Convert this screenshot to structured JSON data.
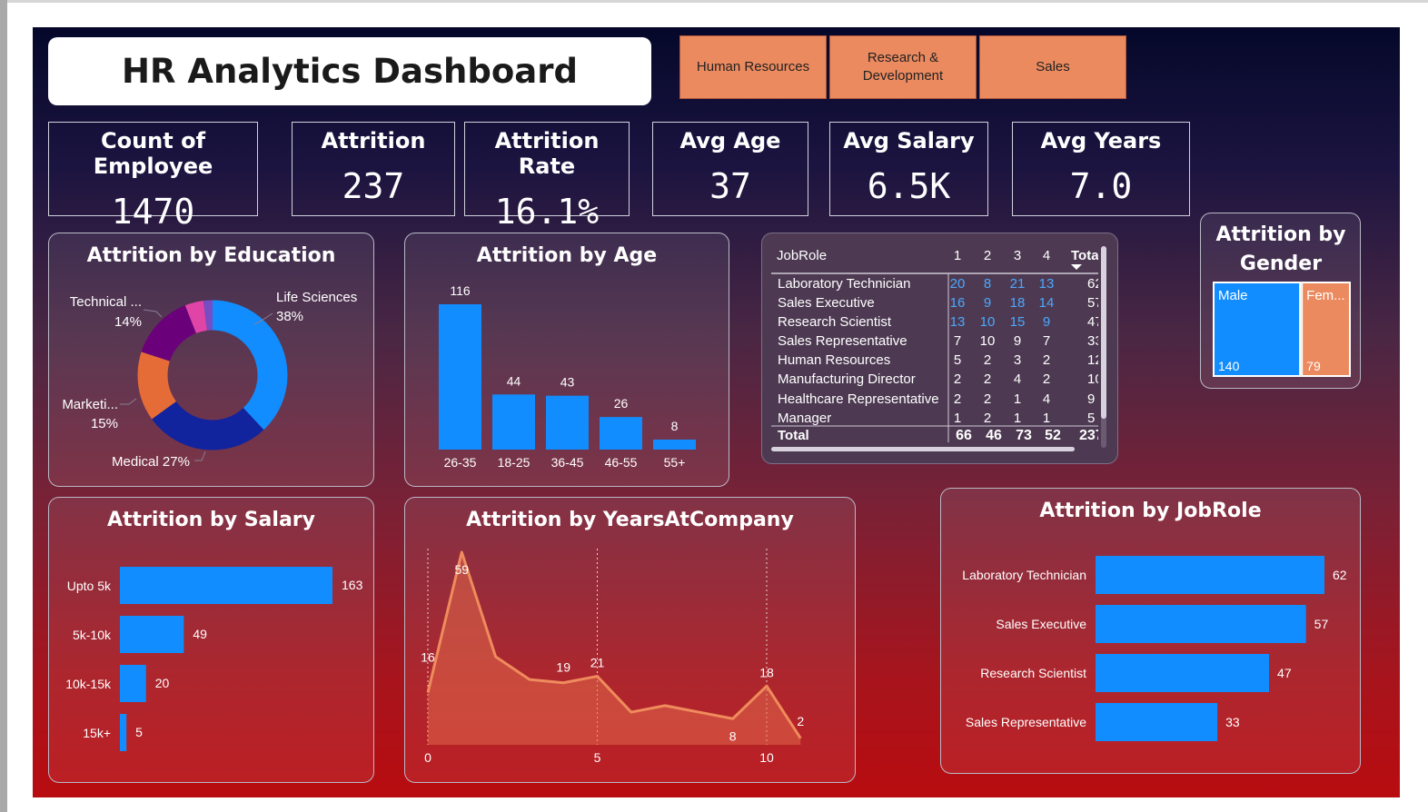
{
  "title": "HR Analytics Dashboard",
  "slicers": [
    "Human Resources",
    "Research & Development",
    "Sales"
  ],
  "kpis": [
    {
      "label": "Count of Employee",
      "value": "1470"
    },
    {
      "label": "Attrition",
      "value": "237"
    },
    {
      "label": "Attrition Rate",
      "value": "16.1%"
    },
    {
      "label": "Avg Age",
      "value": "37"
    },
    {
      "label": "Avg Salary",
      "value": "6.5K"
    },
    {
      "label": "Avg Years",
      "value": "7.0"
    }
  ],
  "colors": {
    "bar": "#118dff",
    "accent": "#ec8a5f",
    "line": "#ef8b5c"
  },
  "chart_data": [
    {
      "type": "pie",
      "title": "Attrition by Education",
      "slices": [
        {
          "name": "Life Sciences",
          "percent": 38,
          "label": "Life Sciences",
          "pct_label": "38%",
          "color": "#118dff"
        },
        {
          "name": "Medical",
          "percent": 27,
          "label": "Medical 27%",
          "color": "#12239e"
        },
        {
          "name": "Marketing",
          "percent": 15,
          "label": "Marketi...",
          "pct_label": "15%",
          "color": "#e66c37"
        },
        {
          "name": "Technical Degree",
          "percent": 14,
          "label": "Technical ...",
          "pct_label": "14%",
          "color": "#6b007b"
        },
        {
          "name": "Other",
          "percent": 4,
          "color": "#e044a7"
        },
        {
          "name": "Human Resources",
          "percent": 2,
          "color": "#744ec2"
        }
      ]
    },
    {
      "type": "bar",
      "title": "Attrition by Age",
      "categories": [
        "26-35",
        "18-25",
        "36-45",
        "46-55",
        "55+"
      ],
      "values": [
        116,
        44,
        43,
        26,
        8
      ]
    },
    {
      "type": "table",
      "columns": [
        "JobRole",
        "1",
        "2",
        "3",
        "4",
        "Tota"
      ],
      "rows": [
        {
          "role": "Laboratory Technician",
          "v": [
            "20",
            "8",
            "21",
            "13"
          ],
          "total": "62"
        },
        {
          "role": "Sales Executive",
          "v": [
            "16",
            "9",
            "18",
            "14"
          ],
          "total": "57"
        },
        {
          "role": "Research Scientist",
          "v": [
            "13",
            "10",
            "15",
            "9"
          ],
          "total": "47"
        },
        {
          "role": "Sales Representative",
          "v": [
            "7",
            "10",
            "9",
            "7"
          ],
          "total": "33"
        },
        {
          "role": "Human Resources",
          "v": [
            "5",
            "2",
            "3",
            "2"
          ],
          "total": "12"
        },
        {
          "role": "Manufacturing Director",
          "v": [
            "2",
            "2",
            "4",
            "2"
          ],
          "total": "10"
        },
        {
          "role": "Healthcare Representative",
          "v": [
            "2",
            "2",
            "1",
            "4"
          ],
          "total": "9"
        },
        {
          "role": "Manager",
          "v": [
            "1",
            "2",
            "1",
            "1"
          ],
          "total": "5"
        }
      ],
      "total_row": {
        "role": "Total",
        "v": [
          "66",
          "46",
          "73",
          "52"
        ],
        "total": "237"
      }
    },
    {
      "type": "treemap",
      "title": "Attrition by Gender",
      "items": [
        {
          "name": "Male",
          "value": 140,
          "color": "#118dff"
        },
        {
          "name": "Fem...",
          "value": 79,
          "color": "#ec8a5f"
        }
      ]
    },
    {
      "type": "bar",
      "orientation": "horizontal",
      "title": "Attrition by Salary",
      "categories": [
        "Upto 5k",
        "5k-10k",
        "10k-15k",
        "15k+"
      ],
      "values": [
        163,
        49,
        20,
        5
      ]
    },
    {
      "type": "area",
      "title": "Attrition by YearsAtCompany",
      "x": [
        0,
        1,
        2,
        3,
        4,
        5,
        6,
        7,
        8,
        9,
        10,
        11
      ],
      "y": [
        16,
        59,
        27,
        20,
        19,
        21,
        10,
        12,
        10,
        8,
        18,
        2
      ],
      "labeled_points": [
        0,
        1,
        4,
        5,
        9,
        10,
        11
      ],
      "xticks": [
        0,
        5,
        10
      ],
      "xlim": [
        0,
        11
      ],
      "ylim": [
        0,
        60
      ]
    },
    {
      "type": "bar",
      "orientation": "horizontal",
      "title": "Attrition by JobRole",
      "categories": [
        "Laboratory Technician",
        "Sales Executive",
        "Research Scientist",
        "Sales Representative"
      ],
      "values": [
        62,
        57,
        47,
        33
      ]
    }
  ]
}
